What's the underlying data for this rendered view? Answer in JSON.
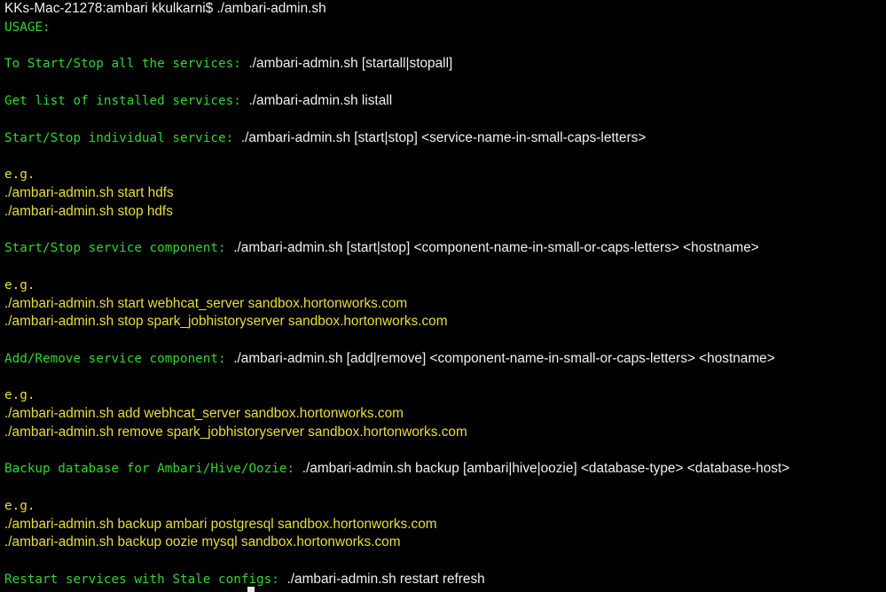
{
  "prompt": {
    "text": "KKs-Mac-21278:ambari kkulkarni$",
    "command": "./ambari-admin.sh"
  },
  "usage": "USAGE:",
  "sections": {
    "start_stop_all": {
      "label": "To Start/Stop all the services:",
      "command": "./ambari-admin.sh [startall|stopall]"
    },
    "list_services": {
      "label": "Get list of installed services:",
      "command": "./ambari-admin.sh listall"
    },
    "individual_service": {
      "label": "Start/Stop individual service:",
      "command": "./ambari-admin.sh [start|stop] <service-name-in-small-caps-letters>",
      "eg": "e.g.",
      "examples": [
        "./ambari-admin.sh start hdfs",
        "./ambari-admin.sh stop hdfs"
      ]
    },
    "service_component": {
      "label": "Start/Stop service component:",
      "command": "./ambari-admin.sh [start|stop] <component-name-in-small-or-caps-letters> <hostname>",
      "eg": "e.g.",
      "examples": [
        "./ambari-admin.sh start webhcat_server sandbox.hortonworks.com",
        "./ambari-admin.sh stop spark_jobhistoryserver sandbox.hortonworks.com"
      ]
    },
    "add_remove_component": {
      "label": "Add/Remove service component:",
      "command": "./ambari-admin.sh [add|remove] <component-name-in-small-or-caps-letters> <hostname>",
      "eg": "e.g.",
      "examples": [
        "./ambari-admin.sh add webhcat_server sandbox.hortonworks.com",
        "./ambari-admin.sh remove spark_jobhistoryserver sandbox.hortonworks.com"
      ]
    },
    "backup_database": {
      "label": "Backup database for Ambari/Hive/Oozie:",
      "command": "./ambari-admin.sh backup [ambari|hive|oozie] <database-type> <database-host>",
      "eg": "e.g.",
      "examples": [
        "./ambari-admin.sh backup ambari postgresql sandbox.hortonworks.com",
        "./ambari-admin.sh backup oozie mysql sandbox.hortonworks.com"
      ]
    },
    "restart_stale": {
      "label": "Restart services with Stale configs:",
      "command": "./ambari-admin.sh restart refresh"
    }
  },
  "colors": {
    "background": "#000000",
    "label_green": "#2fd62f",
    "command_white": "#f0f0f0",
    "example_yellow": "#e8de3c",
    "cursor": "#e6e6e6"
  }
}
